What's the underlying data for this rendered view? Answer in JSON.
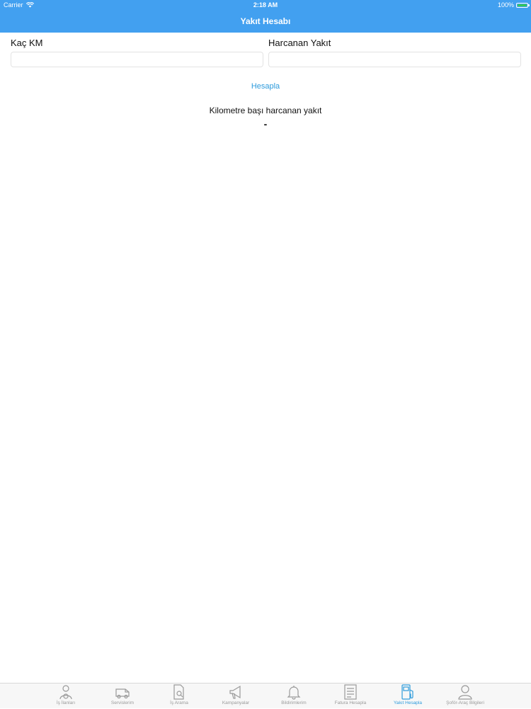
{
  "status_bar": {
    "carrier": "Carrier",
    "time": "2:18 AM",
    "battery": "100%",
    "battery_color": "#35c659"
  },
  "nav": {
    "title": "Yakıt Hesabı",
    "color": "#42a0f0"
  },
  "form": {
    "km_label": "Kaç KM",
    "km_value": "",
    "fuel_label": "Harcanan Yakıt",
    "fuel_value": "",
    "calculate_label": "Hesapla"
  },
  "result": {
    "title": "Kilometre başı harcanan yakıt",
    "value": "-"
  },
  "tabs": [
    {
      "label": "İş İlanları",
      "icon": "driver-icon",
      "active": false
    },
    {
      "label": "Servislerim",
      "icon": "van-icon",
      "active": false
    },
    {
      "label": "İş Arama",
      "icon": "document-search-icon",
      "active": false
    },
    {
      "label": "Kampanyalar",
      "icon": "megaphone-icon",
      "active": false
    },
    {
      "label": "Bildirimlerim",
      "icon": "bell-icon",
      "active": false
    },
    {
      "label": "Fatura Hesapla",
      "icon": "invoice-icon",
      "active": false
    },
    {
      "label": "Yakıt Hesapla",
      "icon": "fuel-pump-icon",
      "active": true
    },
    {
      "label": "Şoför-Araç Bilgileri",
      "icon": "user-icon",
      "active": false
    }
  ],
  "colors": {
    "accent": "#2e9bdc",
    "tab_inactive": "#9a9a9a"
  }
}
